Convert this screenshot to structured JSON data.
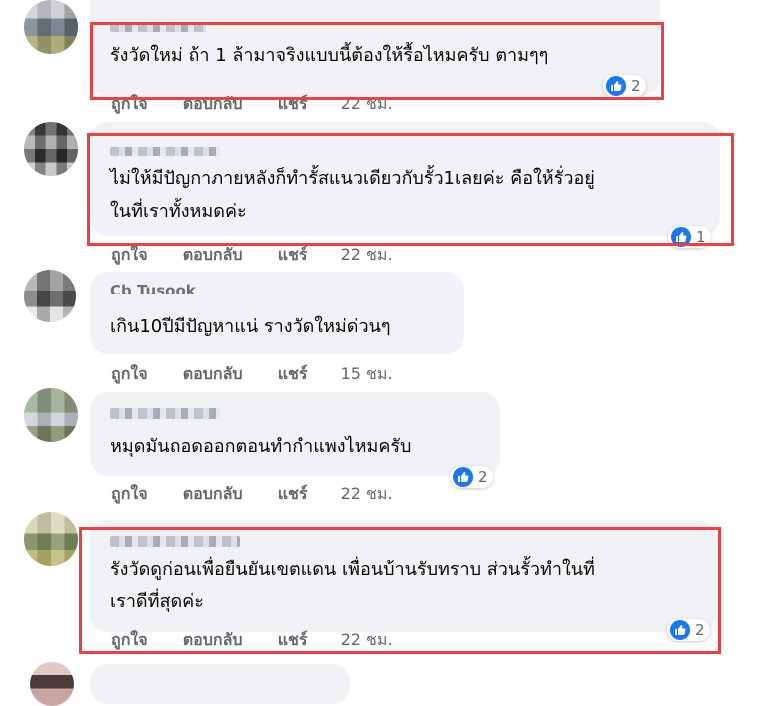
{
  "actions": {
    "like": "ถูกใจ",
    "reply": "ตอบกลับ",
    "share": "แชร์"
  },
  "comments": [
    {
      "text_lines": [
        "รังวัดใหม่ ถ้า 1 ล้ามาจริงแบบนี้ต้องให้รื้อไหมครับ ตามๆๆ"
      ],
      "time": "22 ชม.",
      "reactions": "2",
      "highlighted": true
    },
    {
      "text_lines": [
        "ไม่ให้มีปัญกาภายหลังก็ทำรั้สแนวเดียวกับรั้ว1เลยค่ะ คือให้รั่วอยู่",
        "ในที่เราทั้งหมดค่ะ"
      ],
      "time": "22 ชม.",
      "reactions": "1",
      "highlighted": true
    },
    {
      "author_fragment": "Cb Tusook",
      "text_lines": [
        "เกิน10ปีมีปัญหาแน่ รางวัดใหม่ด่วนๆ"
      ],
      "time": "15 ชม."
    },
    {
      "text_lines": [
        "หมุดมันถอดออกตอนทำกำแพงไหมครับ"
      ],
      "time": "22 ชม.",
      "reactions": "2"
    },
    {
      "text_lines": [
        "รังวัดดูก่อนเพื่อยืนยันเขตแดน เพื่อนบ้านรับทราบ ส่วนรั้วทำในที่",
        "เราดีที่สุดค่ะ"
      ],
      "time": "22 ชม.",
      "reactions": "2",
      "highlighted": true
    }
  ],
  "colors": {
    "highlight": "#ef3f43",
    "bubble": "#f0f2f5",
    "like": "#1877f2",
    "secondary_text": "#65676b"
  },
  "icons": {
    "reaction": "like-thumbs-up-icon"
  }
}
